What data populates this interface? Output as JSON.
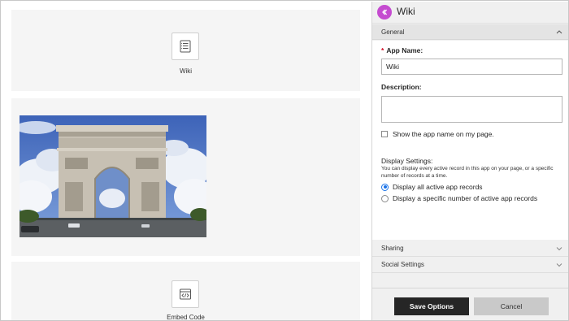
{
  "canvas": {
    "wiki_tile": {
      "icon": "wiki-document-icon",
      "label": "Wiki"
    },
    "image_tile": {
      "icon": "arc-de-triomphe-photo"
    },
    "embed_tile": {
      "icon": "embed-code-icon",
      "label": "Embed Code"
    }
  },
  "panel": {
    "back_icon": "chevron-left-icon",
    "title": "Wiki",
    "accent_color": "#c54bd0",
    "general": {
      "label": "General",
      "icon": "chevron-up-icon"
    },
    "app_name": {
      "label": "App Name:",
      "required_mark": "*",
      "value": "Wiki"
    },
    "description": {
      "label": "Description:",
      "value": ""
    },
    "show_name": {
      "label": "Show the app name on my page.",
      "checked": false
    },
    "display_settings": {
      "label": "Display Settings:",
      "help": "You can display every active record in this app on your page, or a specific number of records at a time.",
      "options": [
        {
          "label": "Display all active app records",
          "selected": true
        },
        {
          "label": "Display a specific number of active app records",
          "selected": false
        }
      ]
    },
    "sharing": {
      "label": "Sharing",
      "icon": "chevron-down-icon"
    },
    "social": {
      "label": "Social Settings",
      "icon": "chevron-down-icon"
    },
    "footer": {
      "save_label": "Save Options",
      "cancel_label": "Cancel"
    }
  }
}
